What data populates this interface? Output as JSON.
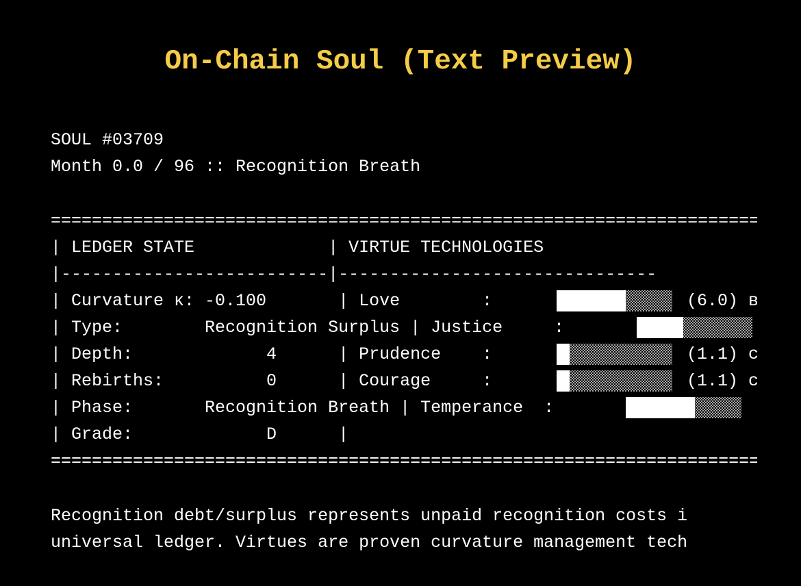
{
  "title": "On-Chain Soul (Text Preview)",
  "header": {
    "soul_id": "SOUL #03709",
    "month_line": "Month 0.0 / 96 :: Recognition Breath"
  },
  "table": {
    "rule_top": "===========================================================================",
    "header_row": "| LEDGER STATE             | VIRTUE TECHNOLOGIES",
    "divider_row": "|--------------------------|-------------------------------",
    "rows": [
      "| Curvature κ: -0.100       | Love        :",
      "| Type:        Recognition Surplus | Justice     :",
      "| Depth:             4      | Prudence    :",
      "| Rebirths:          0      | Courage     :",
      "| Phase:       Recognition Breath | Temperance  :",
      "| Grade:             D      |"
    ],
    "rule_bottom": "==========================================================================="
  },
  "virtues": [
    {
      "name": "Love",
      "fill_fraction": 0.6,
      "score_text": "(6.0) в"
    },
    {
      "name": "Justice",
      "fill_fraction": 0.4,
      "score_text": ""
    },
    {
      "name": "Prudence",
      "fill_fraction": 0.11,
      "score_text": "(1.1) с"
    },
    {
      "name": "Courage",
      "fill_fraction": 0.11,
      "score_text": "(1.1) с"
    },
    {
      "name": "Temperance",
      "fill_fraction": 0.6,
      "score_text": ""
    }
  ],
  "footer": {
    "line1": "Recognition debt/surplus represents unpaid recognition costs i",
    "line2": "universal ledger. Virtues are proven curvature management tech"
  },
  "colors": {
    "background": "#000000",
    "title": "#f5cc47",
    "text": "#ffffff",
    "bar_fill": "#ffffff",
    "bar_empty_dots": "#cfcfcf"
  }
}
